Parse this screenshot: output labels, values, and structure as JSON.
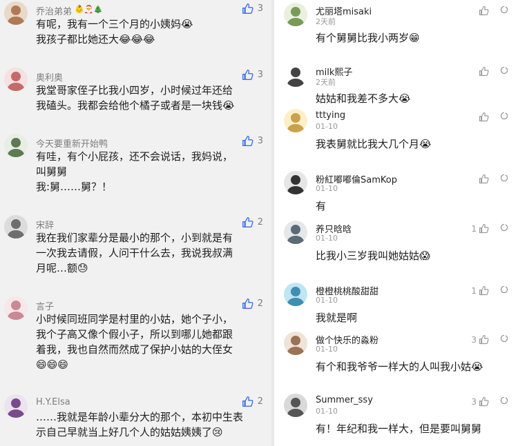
{
  "left_comments": [
    {
      "name": "乔治弟弟",
      "deco": "👶🎅🎄",
      "likes": "3",
      "lines": [
        "有呢，我有一个三个月的小姨妈😭",
        "我孩子都比她还大😂😂😂"
      ]
    },
    {
      "name": "奥利奥",
      "deco": "",
      "likes": "3",
      "lines": [
        "我堂哥家侄子比我小四岁，小时候过年还给",
        "我磕头。我都会给他个橘子或者是一块钱😭"
      ]
    },
    {
      "name": "今天要重新开始鸭",
      "deco": "",
      "likes": "3",
      "lines": [
        "有哇，有个小屁孩，还不会说话，我妈说，",
        "叫舅舅",
        "我:舅……舅？！"
      ]
    },
    {
      "name": "宋辞",
      "deco": "",
      "likes": "2",
      "lines": [
        "我在我们家辈分是最小的那个，小到就是有",
        "一次我去请假，人问干什么去，我说我叔满",
        "月呢…额😓"
      ]
    },
    {
      "name": "言子",
      "deco": "",
      "likes": "2",
      "lines": [
        "小时候同班同学是村里的小姑，她个子小，",
        "我个子高又像个假小子，所以到哪儿她都跟",
        "着我，我也自然而然成了保护小姑的大侄女",
        "😄😄😄"
      ]
    },
    {
      "name": "H.Y.Elsa",
      "deco": "",
      "likes": "2",
      "lines": [
        "……我就是年龄小辈分大的那个，本初中生表",
        "示自己早就当上好几个人的姑姑姨姨了😢"
      ]
    }
  ],
  "right_comments": [
    {
      "name": "尤丽塔misaki",
      "time": "2天前",
      "likes": "",
      "text": "有个舅舅比我小两岁😁"
    },
    {
      "name": "milk熙子",
      "time": "2天前",
      "likes": "",
      "text": "姑姑和我差不多大😭"
    },
    {
      "name": "tttying",
      "time": "01-10",
      "likes": "",
      "text": "我表舅就比我大几个月😭"
    },
    {
      "name": "粉紅嘟嘟倫SamKop",
      "time": "01-10",
      "likes": "",
      "text": "有"
    },
    {
      "name": "养只晗晗",
      "time": "01-10",
      "likes": "1",
      "text": "比我小三岁我叫她姑姑😱"
    },
    {
      "name": "橙橙桃桃酸甜甜",
      "time": "01-10",
      "likes": "1",
      "text": "我就是啊"
    },
    {
      "name": "做个快乐的淼粉",
      "time": "01-10",
      "likes": "3",
      "text": "有个和我爷爷一样大的人叫我小姑😭"
    },
    {
      "name": "Summer_ssy",
      "time": "01-10",
      "likes": "3",
      "text": "有！年纪和我一样大，但是要叫舅舅"
    }
  ],
  "colors": {
    "left_bg": "#f1f1f1",
    "right_bg": "#ffffff",
    "name_gray": "#7d7d7d",
    "like_blue": "#3d6ee8",
    "time_gray": "#999999"
  },
  "icons": {
    "like": "thumbs-up-icon",
    "reply": "reply-bubble-icon"
  }
}
